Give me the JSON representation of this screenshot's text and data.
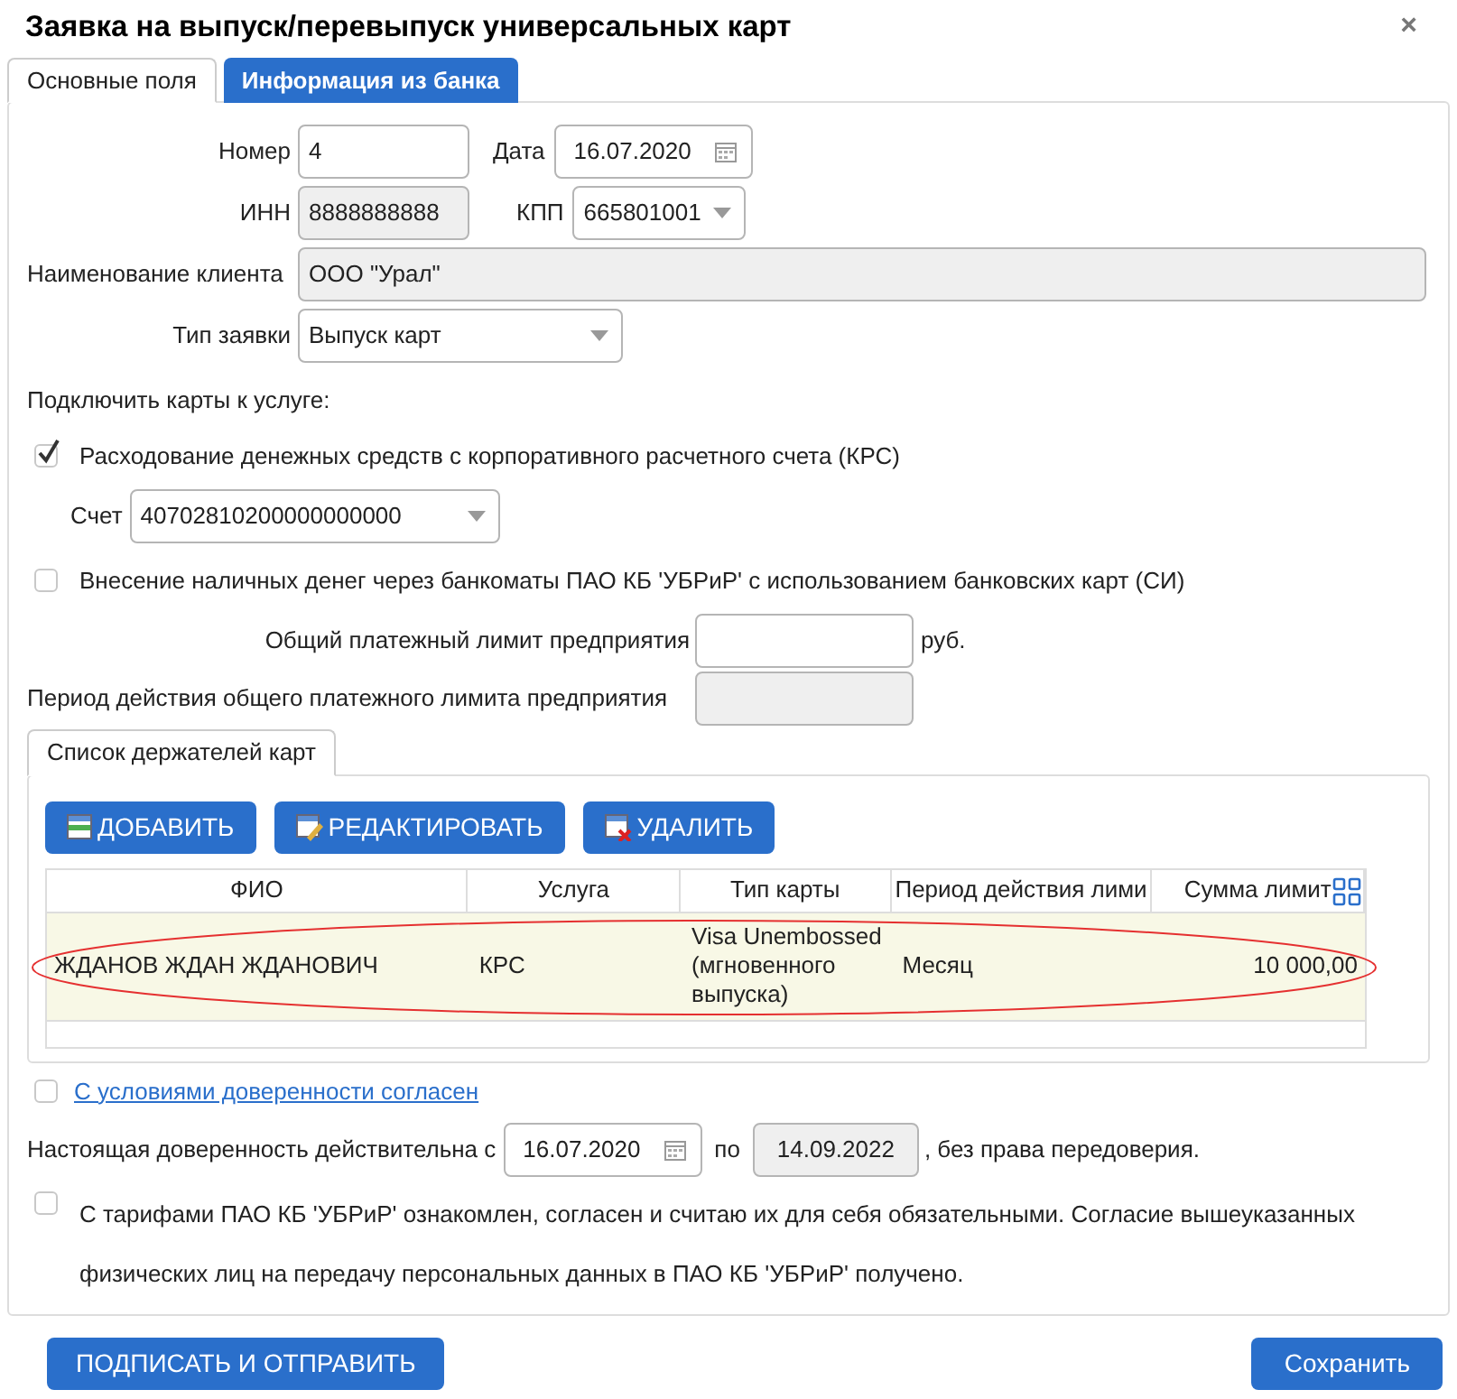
{
  "window": {
    "title": "Заявка на выпуск/перевыпуск универсальных карт",
    "close": "×"
  },
  "tabs": [
    {
      "label": "Основные поля",
      "selected": true
    },
    {
      "label": "Информация из банка",
      "selected": false
    }
  ],
  "number": {
    "label": "Номер",
    "value": "4",
    "disabled": false
  },
  "date": {
    "label": "Дата",
    "value": "16.07.2020",
    "disabled": false
  },
  "inn": {
    "label": "ИНН",
    "value": "8888888888",
    "disabled": true
  },
  "kpp": {
    "label": "КПП",
    "value": "665801001",
    "disabled": false
  },
  "client": {
    "label": "Наименование клиента",
    "value": "ООО \"Урал\"",
    "disabled": true
  },
  "request_type": {
    "label": "Тип заявки",
    "value": "Выпуск карт",
    "disabled": false
  },
  "services_heading": "Подключить карты к услуге:",
  "services": [
    {
      "label": "Расходование денежных средств с корпоративного расчетного счета (КРС)",
      "checked": true,
      "account": {
        "label": "Счет",
        "value": "40702810200000000000"
      }
    },
    {
      "label": "Внесение наличных денег через банкоматы ПАО КБ 'УБРиР' с использованием банковских карт (СИ)",
      "checked": false
    }
  ],
  "limit": {
    "label": "Общий платежный лимит предприятия",
    "unit": "руб.",
    "disabled": false
  },
  "limit_period": {
    "label": "Период действия общего платежного лимита предприятия",
    "disabled": true
  },
  "holders_tabs": [
    {
      "label": "Список держателей карт",
      "selected": true
    }
  ],
  "toolbar": [
    {
      "label": "ДОБАВИТЬ",
      "kind": "add"
    },
    {
      "label": "РЕДАКТИРОВАТЬ",
      "kind": "edit"
    },
    {
      "label": "УДАЛИТЬ",
      "kind": "delete"
    }
  ],
  "table": {
    "columns": [
      "ФИО",
      "Услуга",
      "Тип карты",
      "Период действия лими",
      "Сумма лимит"
    ],
    "rows": [
      {
        "cells": [
          "ЖДАНОВ ЖДАН ЖДАНОВИЧ",
          "КРС",
          "Visa Unembossed (мгновенного выпуска)",
          "Месяц",
          "10 000,00"
        ],
        "selected": true,
        "circled": true
      }
    ]
  },
  "agree_terms": {
    "label": "С условиями доверенности согласен",
    "checked": false
  },
  "validity": {
    "prefix": "Настоящая доверенность действительна с",
    "from": {
      "value": "16.07.2020",
      "disabled": false
    },
    "to_label": "по",
    "to": {
      "value": "14.09.2022",
      "disabled": true
    },
    "suffix": ", без права передоверия."
  },
  "agree_tariffs": {
    "label": "С тарифами ПАО КБ 'УБРиР' ознакомлен, согласен и считаю их для себя обязательными. Согласие вышеуказанных физических лиц на передачу персональных данных в ПАО КБ 'УБРиР' получено.",
    "checked": false
  },
  "buttons": [
    {
      "label": "ПОДПИСАТЬ И ОТПРАВИТЬ"
    },
    {
      "label": "Сохранить"
    }
  ]
}
